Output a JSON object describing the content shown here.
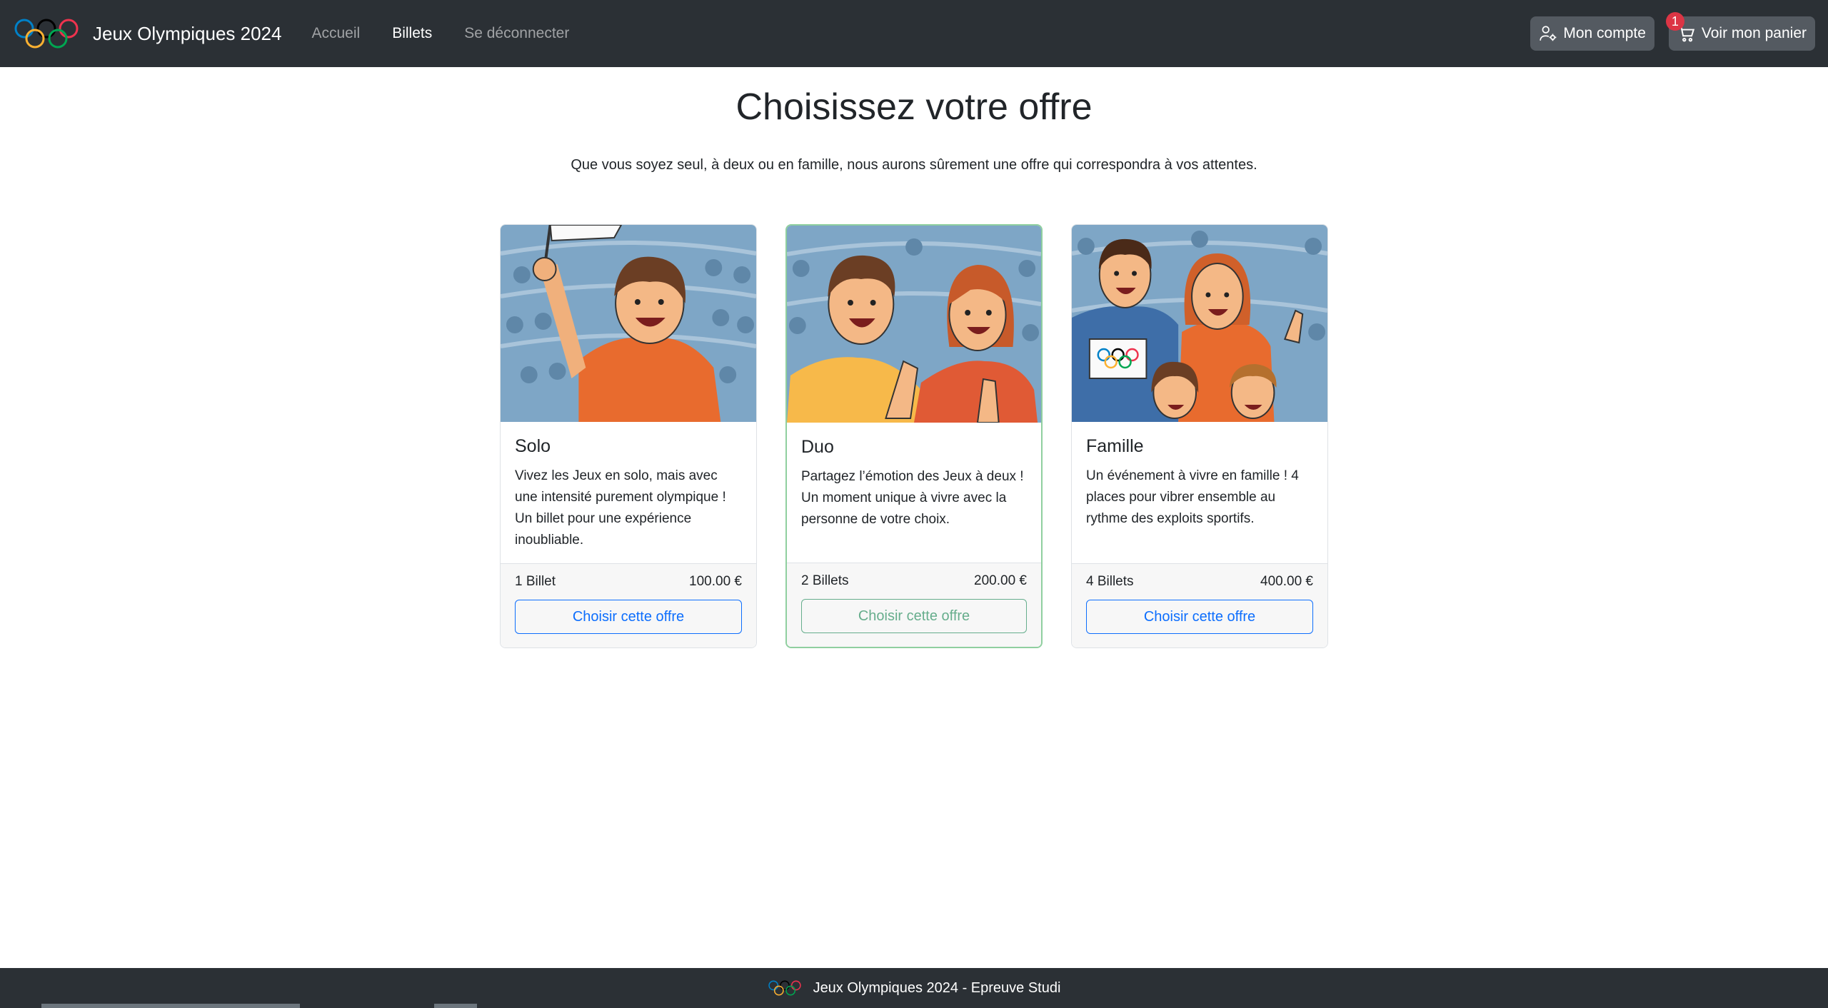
{
  "navbar": {
    "brand": "Jeux Olympiques 2024",
    "links": [
      {
        "label": "Accueil",
        "active": false
      },
      {
        "label": "Billets",
        "active": true
      },
      {
        "label": "Se déconnecter",
        "active": false
      }
    ],
    "account_label": "Mon compte",
    "cart_label": "Voir mon panier",
    "cart_count": "1"
  },
  "main": {
    "title": "Choisissez votre offre",
    "lead": "Que vous soyez seul, à deux ou en famille, nous aurons sûrement une offre qui correspondra à vos attentes.",
    "offers": [
      {
        "title": "Solo",
        "description": "Vivez les Jeux en solo, mais avec une intensité purement olympique ! Un billet pour une expérience inoubliable.",
        "tickets": "1 Billet",
        "price": "100.00 €",
        "button": "Choisir cette offre"
      },
      {
        "title": "Duo",
        "description": "Partagez l’émotion des Jeux à deux ! Un moment unique à vivre avec la personne de votre choix.",
        "tickets": "2 Billets",
        "price": "200.00 €",
        "button": "Choisir cette offre"
      },
      {
        "title": "Famille",
        "description": "Un événement à vivre en famille ! 4 places pour vibrer ensemble au rythme des exploits sportifs.",
        "tickets": "4 Billets",
        "price": "400.00 €",
        "button": "Choisir cette offre"
      }
    ]
  },
  "footer": {
    "text": "Jeux Olympiques 2024 - Epreuve Studi"
  },
  "icons": {
    "brand": "olympic-rings-icon",
    "account": "user-gear-icon",
    "cart": "cart-icon"
  },
  "colors": {
    "navbar_bg": "#2b3035",
    "primary": "#0d6efd",
    "success": "#198754",
    "badge": "#dc3545"
  }
}
